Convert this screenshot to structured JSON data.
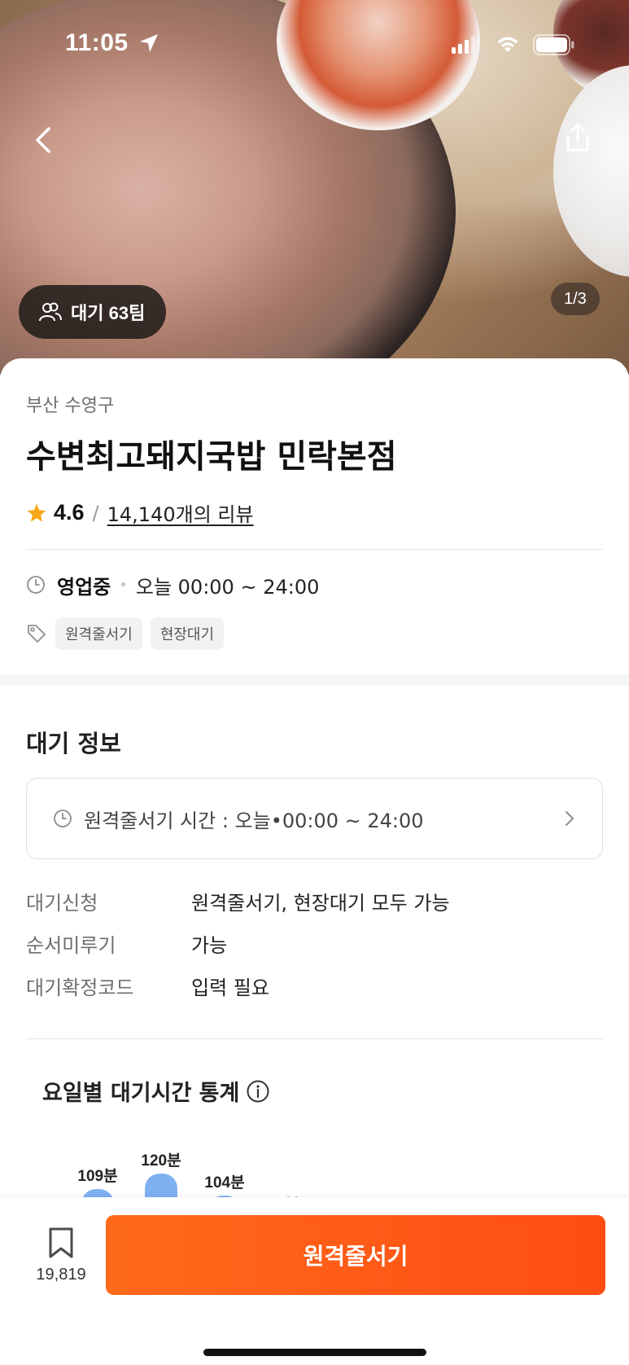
{
  "status_bar": {
    "time": "11:05"
  },
  "hero": {
    "wait_badge": "대기 63팀",
    "page_indicator": "1/3"
  },
  "store": {
    "region": "부산 수영구",
    "name": "수변최고돼지국밥 민락본점",
    "rating": "4.6",
    "rating_separator": "/",
    "review_count": "14,140개의 리뷰",
    "status": "영업중",
    "status_dot": "•",
    "hours": "오늘 00:00 ~ 24:00",
    "tags": [
      "원격줄서기",
      "현장대기"
    ]
  },
  "wait_info": {
    "title": "대기 정보",
    "remote_time": "원격줄서기 시간 : 오늘•00:00 ~ 24:00",
    "rows": [
      {
        "key": "대기신청",
        "value": "원격줄서기, 현장대기 모두 가능"
      },
      {
        "key": "순서미루기",
        "value": "가능"
      },
      {
        "key": "대기확정코드",
        "value": "입력 필요"
      }
    ]
  },
  "stats": {
    "title": "요일별 대기시간 통계",
    "chart_data": {
      "type": "bar",
      "categories": [
        "",
        "",
        "",
        ""
      ],
      "values": [
        109,
        120,
        104,
        null
      ],
      "labels": [
        "109분",
        "120분",
        "104분",
        "..분"
      ],
      "unit": "분"
    }
  },
  "bottom": {
    "bookmark_count": "19,819",
    "cta_label": "원격줄서기"
  },
  "colors": {
    "accent": "#ff5a1a",
    "bar": "#7fb0f2",
    "star": "#f7a81b"
  },
  "icons": [
    "location-arrow-icon",
    "signal-icon",
    "wifi-icon",
    "battery-icon",
    "back-icon",
    "share-icon",
    "people-icon",
    "star-icon",
    "clock-icon",
    "tag-icon",
    "chevron-right-icon",
    "info-icon",
    "bookmark-icon"
  ]
}
